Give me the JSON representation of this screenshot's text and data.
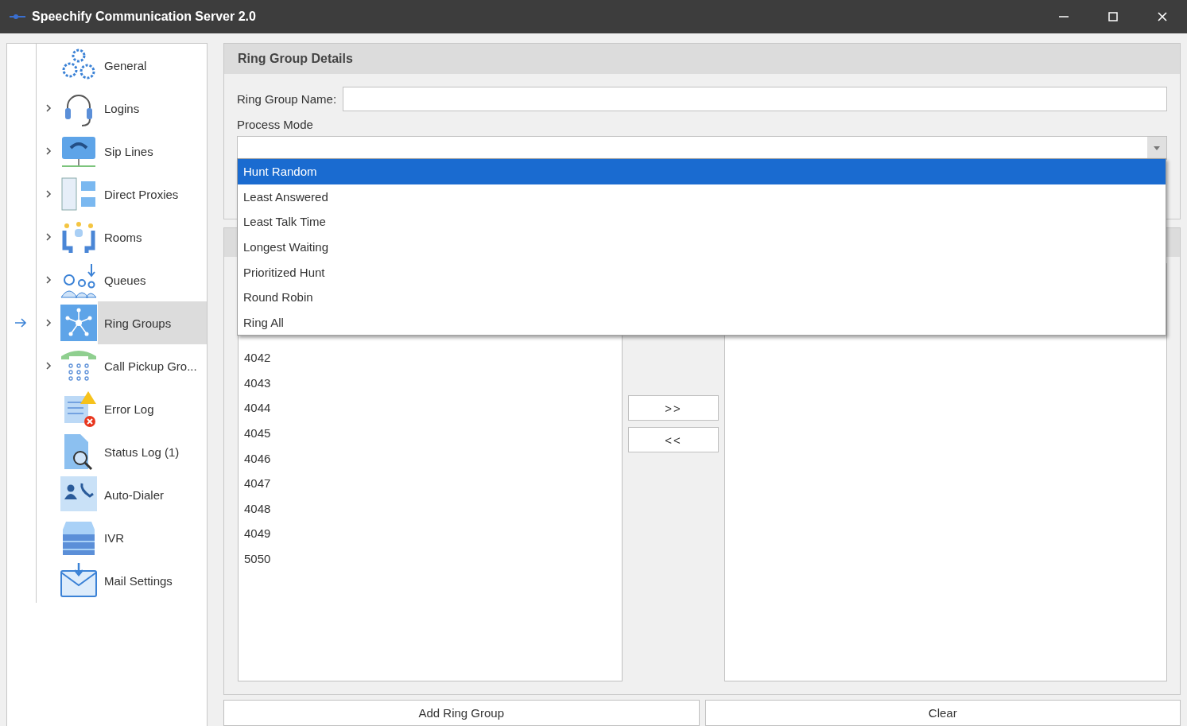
{
  "window": {
    "title": "Speechify Communication Server 2.0"
  },
  "sidebar": {
    "items": [
      {
        "label": "General",
        "expandable": false,
        "selected": false
      },
      {
        "label": "Logins",
        "expandable": true,
        "selected": false
      },
      {
        "label": "Sip Lines",
        "expandable": true,
        "selected": false
      },
      {
        "label": "Direct Proxies",
        "expandable": true,
        "selected": false
      },
      {
        "label": "Rooms",
        "expandable": true,
        "selected": false
      },
      {
        "label": "Queues",
        "expandable": true,
        "selected": false
      },
      {
        "label": "Ring Groups",
        "expandable": true,
        "selected": true
      },
      {
        "label": "Call Pickup Gro...",
        "expandable": true,
        "selected": false
      },
      {
        "label": "Error Log",
        "expandable": false,
        "selected": false
      },
      {
        "label": "Status Log (1)",
        "expandable": false,
        "selected": false
      },
      {
        "label": "Auto-Dialer",
        "expandable": false,
        "selected": false
      },
      {
        "label": "IVR",
        "expandable": false,
        "selected": false
      },
      {
        "label": "Mail Settings",
        "expandable": false,
        "selected": false
      }
    ]
  },
  "details": {
    "title": "Ring Group Details",
    "name_label": "Ring Group Name:",
    "mode_label": "Process Mode",
    "mode_options": [
      {
        "label": "Hunt Random",
        "selected": true
      },
      {
        "label": "Least Answered",
        "selected": false
      },
      {
        "label": "Least Talk Time",
        "selected": false
      },
      {
        "label": "Longest Waiting",
        "selected": false
      },
      {
        "label": "Prioritized Hunt",
        "selected": false
      },
      {
        "label": "Round Robin",
        "selected": false
      },
      {
        "label": "Ring All",
        "selected": false
      }
    ]
  },
  "members": {
    "available": [
      "4042",
      "4043",
      "4044",
      "4045",
      "4046",
      "4047",
      "4048",
      "4049",
      "5050"
    ],
    "add_button": ">>",
    "remove_button": "<<"
  },
  "buttons": [
    "Add Ring Group",
    "Clear"
  ]
}
